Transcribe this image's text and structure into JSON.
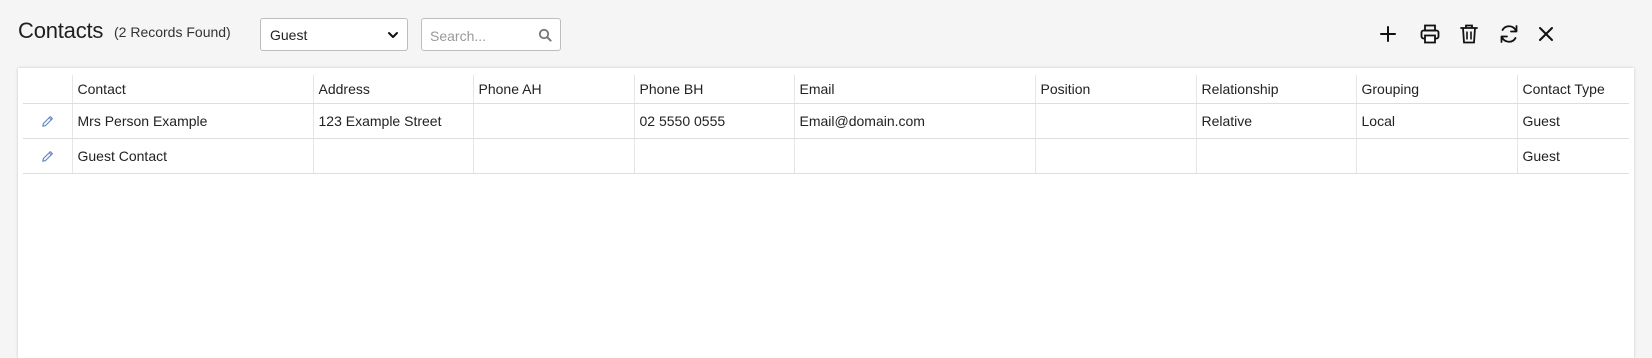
{
  "header": {
    "title": "Contacts",
    "record_count": "(2 Records Found)"
  },
  "filter": {
    "selected": "Guest"
  },
  "search": {
    "placeholder": "Search..."
  },
  "toolbar": {
    "icons": [
      "plus-icon",
      "print-icon",
      "trash-icon",
      "refresh-icon",
      "close-icon"
    ]
  },
  "table": {
    "columns": [
      "",
      "Contact",
      "Address",
      "Phone AH",
      "Phone BH",
      "Email",
      "Position",
      "Relationship",
      "Grouping",
      "Contact Type"
    ],
    "rows": [
      [
        "",
        "Mrs Person Example",
        "123 Example Street",
        "",
        "02 5550 0555",
        "Email@domain.com",
        "",
        "Relative",
        "Local",
        "Guest"
      ],
      [
        "",
        "Guest Contact",
        "",
        "",
        "",
        "",
        "",
        "",
        "",
        "Guest"
      ]
    ]
  },
  "colors": {
    "background": "#f5f5f5",
    "panel": "#ffffff",
    "edit_icon": "#6a8bc4"
  }
}
